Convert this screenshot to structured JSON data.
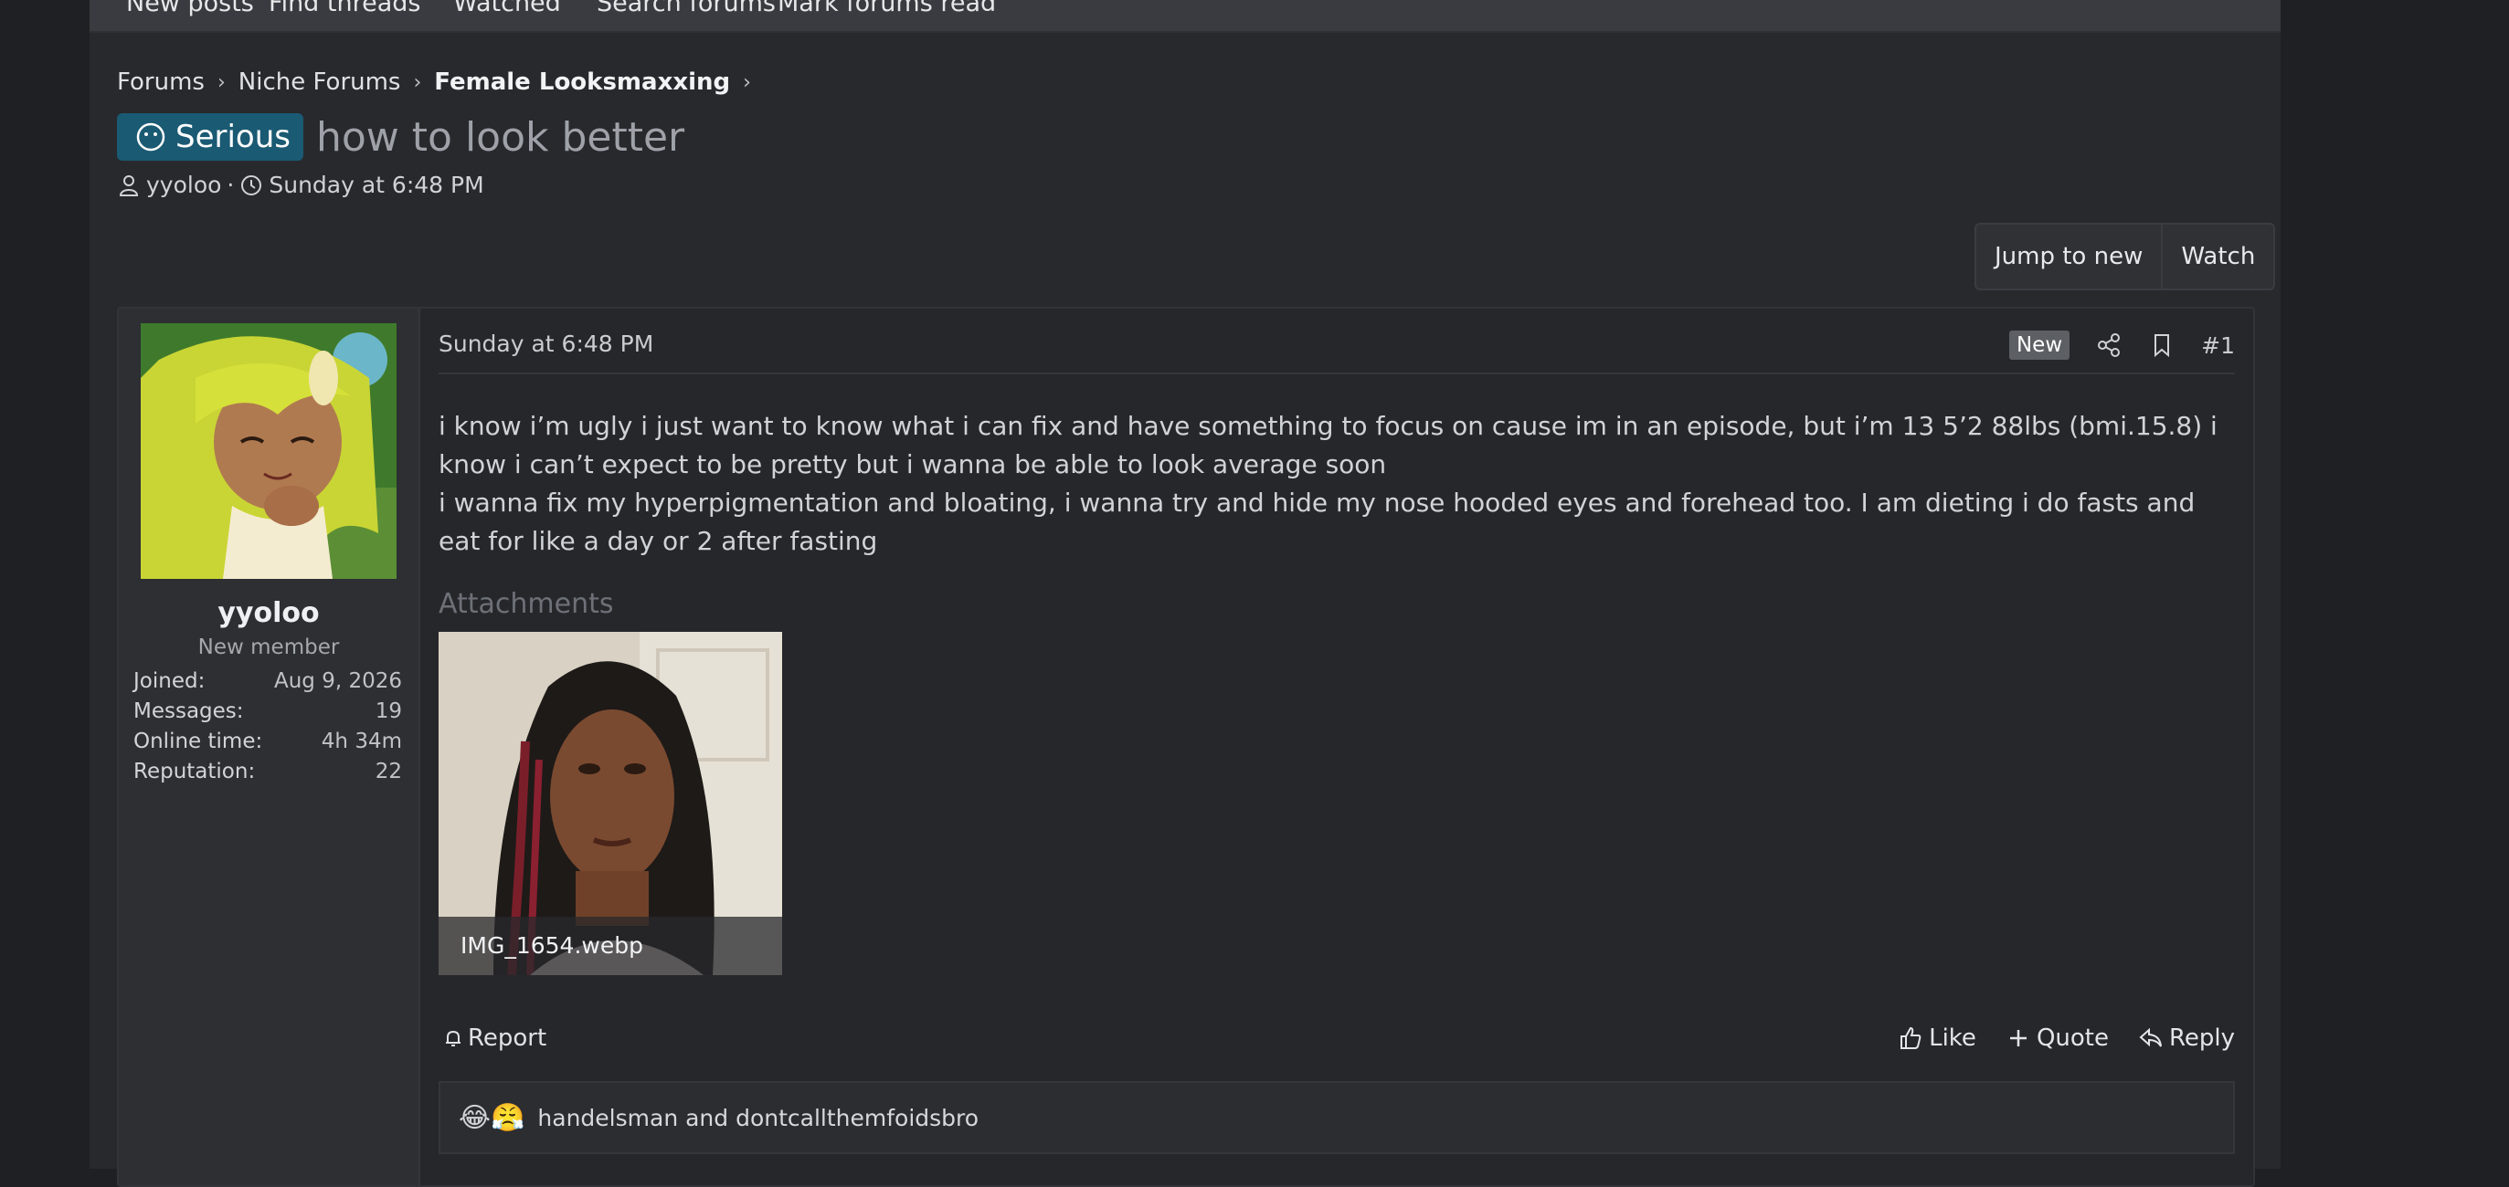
{
  "navbar": {
    "items": [
      "New posts",
      "Find threads",
      "Watched",
      "Search forums",
      "Mark forums read"
    ]
  },
  "breadcrumb": {
    "items": [
      "Forums",
      "Niche Forums",
      "Female Looksmaxxing"
    ]
  },
  "thread": {
    "prefix": "Serious",
    "title": "how to look better",
    "author": "yyoloo",
    "date": "Sunday at 6:48 PM"
  },
  "thread_actions": {
    "jump_to_new": "Jump to new",
    "watch": "Watch"
  },
  "post": {
    "date": "Sunday at 6:48 PM",
    "new_badge": "New",
    "number": "#1",
    "body": [
      "i know i’m ugly i just want to know what i can fix and have something to focus on cause im in an episode, but i’m 13 5’2 88lbs (bmi.15.8) i know i can’t expect to be pretty but i wanna be able to look average soon",
      "i wanna fix my hyperpigmentation and bloating, i wanna try and hide my nose hooded eyes and forehead too. I am dieting i do fasts and eat for like a day or 2 after fasting"
    ],
    "attachments_label": "Attachments",
    "attachment_filename": "IMG_1654.webp",
    "report": "Report",
    "like": "Like",
    "quote": "Quote",
    "reply": "Reply",
    "reactions_emoji": "😂😤",
    "reacted_by": "handelsman and dontcallthemfoidsbro"
  },
  "user": {
    "name": "yyoloo",
    "title": "New member",
    "stats": [
      {
        "label": "Joined:",
        "value": "Aug 9, 2026"
      },
      {
        "label": "Messages:",
        "value": "19"
      },
      {
        "label": "Online time:",
        "value": "4h 34m"
      },
      {
        "label": "Reputation:",
        "value": "22"
      }
    ]
  },
  "colors": {
    "background": "#1f2023",
    "page": "#27292d",
    "prefix_badge": "#1a5a73",
    "text": "#cfd2d6"
  }
}
